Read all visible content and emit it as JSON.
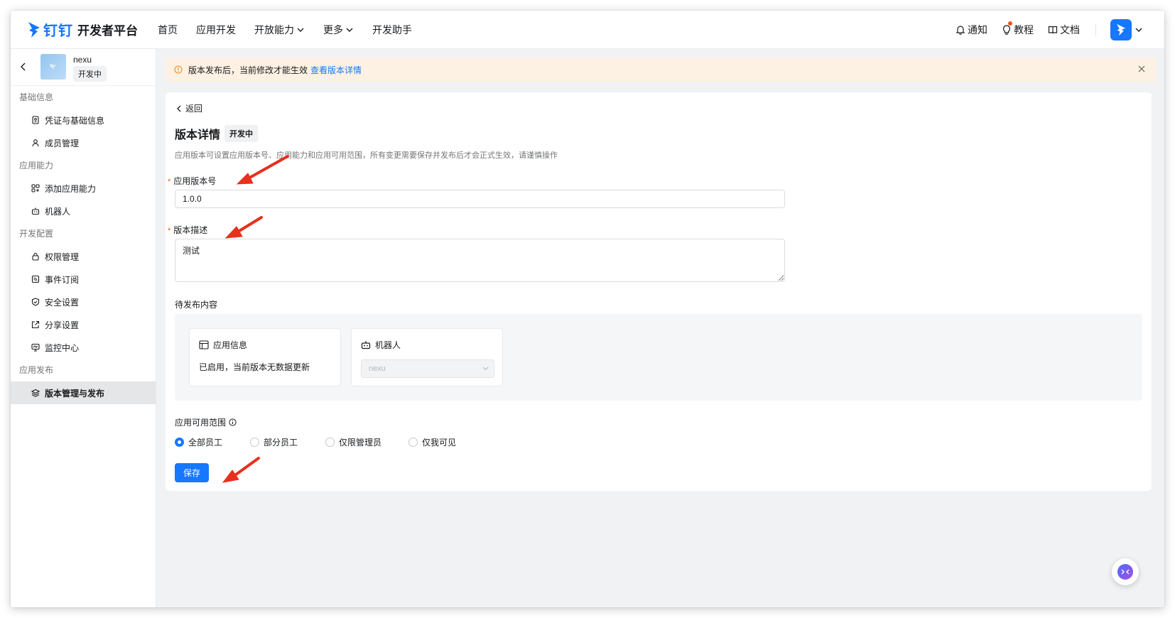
{
  "header": {
    "brand": "钉钉",
    "title": "开发者平台",
    "nav": [
      {
        "label": "首页"
      },
      {
        "label": "应用开发"
      },
      {
        "label": "开放能力"
      },
      {
        "label": "更多"
      },
      {
        "label": "开发助手"
      }
    ],
    "right": {
      "notify": "通知",
      "tutorial": "教程",
      "docs": "文档"
    }
  },
  "sidebar": {
    "app_name": "nexu",
    "app_status": "开发中",
    "groups": [
      {
        "title": "基础信息",
        "items": [
          {
            "label": "凭证与基础信息",
            "icon": "credential-icon"
          },
          {
            "label": "成员管理",
            "icon": "user-icon"
          }
        ]
      },
      {
        "title": "应用能力",
        "items": [
          {
            "label": "添加应用能力",
            "icon": "apps-add-icon"
          },
          {
            "label": "机器人",
            "icon": "robot-icon"
          }
        ]
      },
      {
        "title": "开发配置",
        "items": [
          {
            "label": "权限管理",
            "icon": "lock-icon"
          },
          {
            "label": "事件订阅",
            "icon": "subscribe-icon"
          },
          {
            "label": "安全设置",
            "icon": "shield-icon"
          },
          {
            "label": "分享设置",
            "icon": "share-icon"
          },
          {
            "label": "监控中心",
            "icon": "monitor-icon"
          }
        ]
      },
      {
        "title": "应用发布",
        "items": [
          {
            "label": "版本管理与发布",
            "icon": "layers-icon",
            "active": true
          }
        ]
      }
    ]
  },
  "alert": {
    "text": "版本发布后，当前修改才能生效",
    "link": "查看版本详情"
  },
  "main": {
    "back": "返回",
    "title": "版本详情",
    "status": "开发中",
    "desc": "应用版本可设置应用版本号、应用能力和应用可用范围，所有变更需要保存并发布后才会正式生效，请谨慎操作",
    "version_label": "应用版本号",
    "version_value": "1.0.0",
    "desc_label": "版本描述",
    "desc_value": "测试",
    "pending_label": "待发布内容",
    "app_info_title": "应用信息",
    "app_info_body": "已启用，当前版本无数据更新",
    "robot_title": "机器人",
    "robot_select": "nexu",
    "scope_label": "应用可用范围",
    "scope_options": [
      "全部员工",
      "部分员工",
      "仅限管理员",
      "仅我可见"
    ],
    "scope_selected": "全部员工",
    "save": "保存"
  },
  "colors": {
    "primary": "#1677ff",
    "alert_bg": "#fdf1e3",
    "annotation_arrow": "#e8301c"
  }
}
